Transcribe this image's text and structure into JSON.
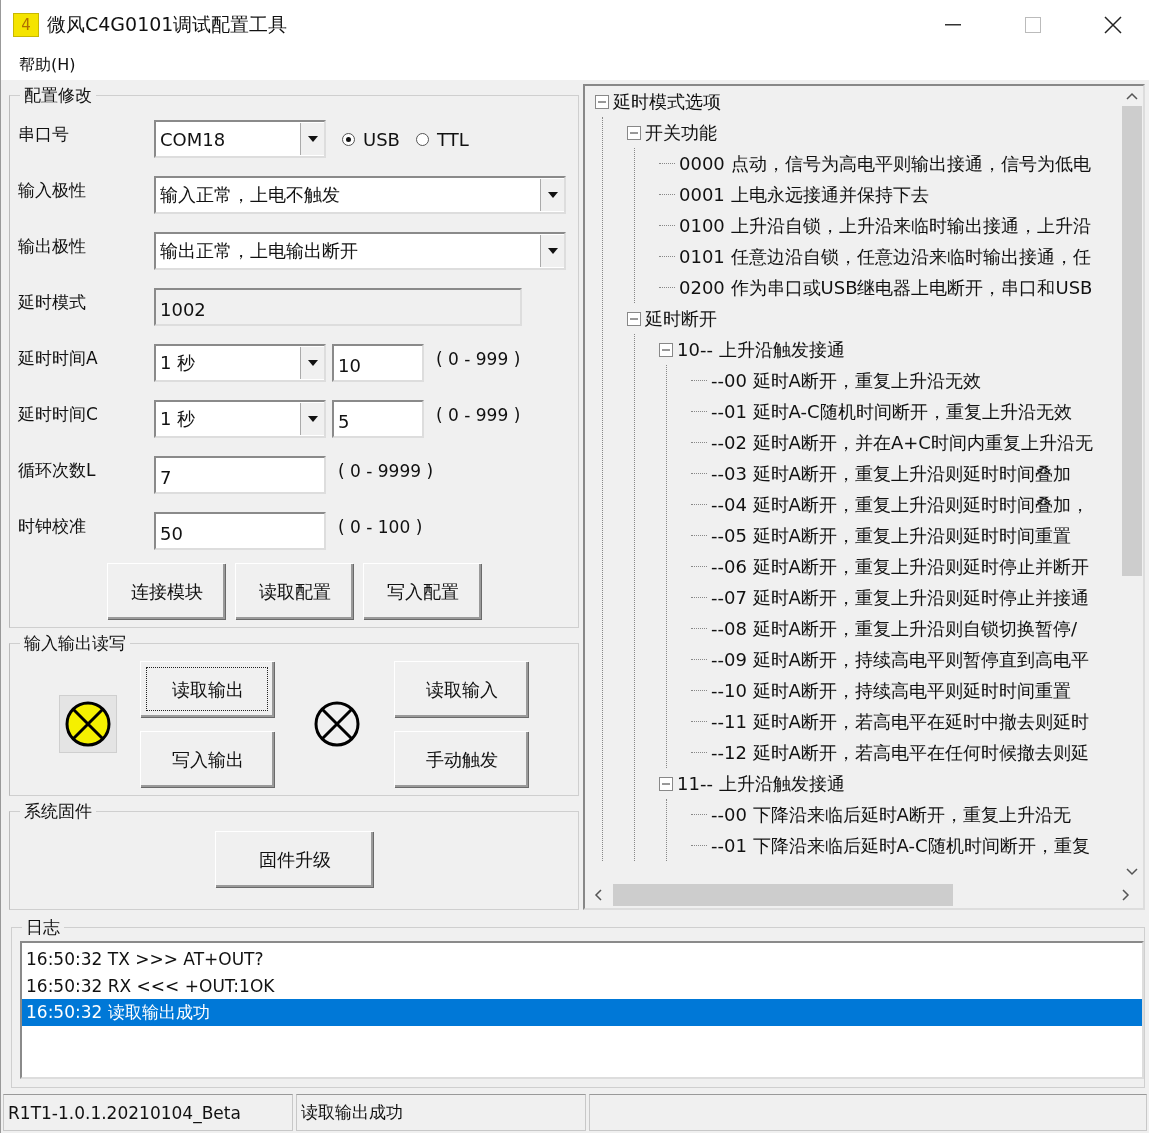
{
  "window": {
    "app_icon_text": "4",
    "title": "微风C4G0101调试配置工具"
  },
  "menu": [
    {
      "label": "帮助(H)"
    }
  ],
  "config": {
    "title": "配置修改",
    "port": {
      "label": "串口号",
      "value": "COM18",
      "radios": [
        {
          "label": "USB",
          "selected": true
        },
        {
          "label": "TTL",
          "selected": false
        }
      ]
    },
    "input_polarity": {
      "label": "输入极性",
      "value": "输入正常，上电不触发"
    },
    "output_polarity": {
      "label": "输出极性",
      "value": "输出正常，上电输出断开"
    },
    "delay_mode": {
      "label": "延时模式",
      "value": "1002"
    },
    "delay_a": {
      "label": "延时时间A",
      "unit": "1 秒",
      "value": "10",
      "range": "( 0 - 999 )"
    },
    "delay_c": {
      "label": "延时时间C",
      "unit": "1 秒",
      "value": "5",
      "range": "( 0 - 999 )"
    },
    "loop_count": {
      "label": "循环次数L",
      "value": "7",
      "range": "( 0 - 9999 )"
    },
    "clock_cal": {
      "label": "时钟校准",
      "value": "50",
      "range": "( 0 - 100 )"
    },
    "buttons": [
      "连接模块",
      "读取配置",
      "写入配置"
    ]
  },
  "io": {
    "title": "输入输出读写",
    "output_lamp": {
      "lit": true
    },
    "output_buttons": [
      {
        "label": "读取输出",
        "focused": true
      },
      {
        "label": "写入输出",
        "focused": false
      }
    ],
    "input_lamp": {
      "lit": false
    },
    "input_buttons": [
      {
        "label": "读取输入",
        "focused": false
      },
      {
        "label": "手动触发",
        "focused": false
      }
    ]
  },
  "firmware": {
    "title": "系统固件",
    "button": "固件升级"
  },
  "tree": [
    {
      "label": "延时模式选项",
      "expanded": true,
      "children": [
        {
          "label": "开关功能",
          "expanded": true,
          "children": [
            {
              "label": "0000 点动，信号为高电平则输出接通，信号为低电"
            },
            {
              "label": "0001 上电永远接通并保持下去"
            },
            {
              "label": "0100 上升沿自锁，上升沿来临时输出接通，上升沿"
            },
            {
              "label": "0101 任意边沿自锁，任意边沿来临时输出接通，任"
            },
            {
              "label": "0200 作为串口或USB继电器上电断开，串口和USB"
            }
          ]
        },
        {
          "label": "延时断开",
          "expanded": true,
          "children": [
            {
              "label": "10-- 上升沿触发接通",
              "expanded": true,
              "children": [
                {
                  "label": "--00 延时A断开，重复上升沿无效"
                },
                {
                  "label": "--01 延时A-C随机时间断开，重复上升沿无效"
                },
                {
                  "label": "--02 延时A断开，并在A+C时间内重复上升沿无"
                },
                {
                  "label": "--03 延时A断开，重复上升沿则延时时间叠加"
                },
                {
                  "label": "--04 延时A断开，重复上升沿则延时时间叠加，"
                },
                {
                  "label": "--05 延时A断开，重复上升沿则延时时间重置"
                },
                {
                  "label": "--06 延时A断开，重复上升沿则延时停止并断开"
                },
                {
                  "label": "--07 延时A断开，重复上升沿则延时停止并接通"
                },
                {
                  "label": "--08 延时A断开，重复上升沿则自锁切换暂停/"
                },
                {
                  "label": "--09 延时A断开，持续高电平则暂停直到高电平"
                },
                {
                  "label": "--10 延时A断开，持续高电平则延时时间重置"
                },
                {
                  "label": "--11 延时A断开，若高电平在延时中撤去则延时"
                },
                {
                  "label": "--12 延时A断开，若高电平在任何时候撤去则延"
                }
              ]
            },
            {
              "label": "11-- 上升沿触发接通",
              "expanded": true,
              "children": [
                {
                  "label": "--00 下降沿来临后延时A断开，重复上升沿无"
                },
                {
                  "label": "--01 下降沿来临后延时A-C随机时间断开，重复"
                }
              ]
            }
          ]
        }
      ]
    }
  ],
  "log": {
    "title": "日志",
    "entries": [
      {
        "text": "16:50:32 TX >>> AT+OUT?",
        "selected": false
      },
      {
        "text": "16:50:32 RX <<< +OUT:1OK",
        "selected": false
      },
      {
        "text": "16:50:32 读取输出成功",
        "selected": true
      }
    ]
  },
  "status_bar": [
    "R1T1-1.0.1.20210104_Beta",
    "读取输出成功"
  ]
}
